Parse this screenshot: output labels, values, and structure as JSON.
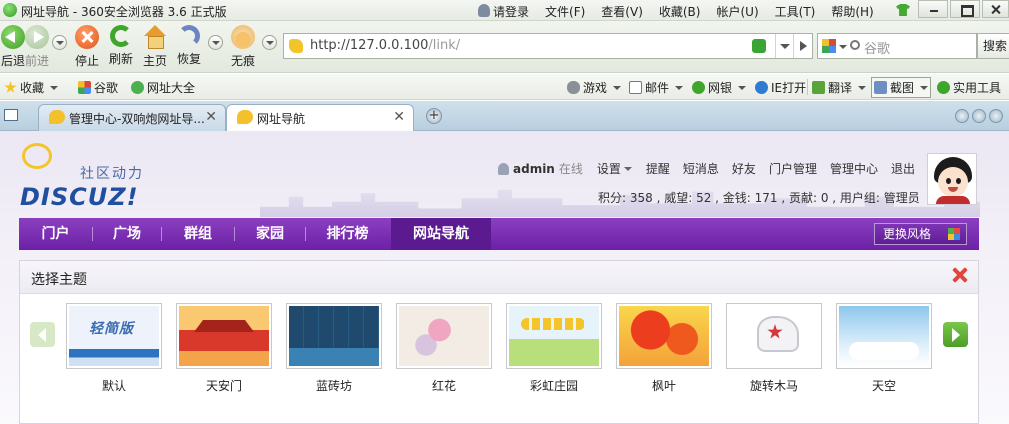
{
  "window": {
    "title": "网址导航 - 360安全浏览器 3.6 正式版",
    "menu": [
      "请登录",
      "文件(F)",
      "查看(V)",
      "收藏(B)",
      "帐户(U)",
      "工具(T)",
      "帮助(H)"
    ]
  },
  "toolbar": {
    "back_label": "后退",
    "forward_label": "前进",
    "stop_label": "停止",
    "refresh_label": "刷新",
    "home_label": "主页",
    "restore_label": "恢复",
    "incognito_label": "无痕",
    "url_host": "http://127.0.0.100",
    "url_path": "/link/",
    "search_placeholder": "谷歌",
    "search_button": "搜索"
  },
  "bookmarks": {
    "left": [
      "收藏",
      "谷歌",
      "网址大全"
    ],
    "right": [
      "游戏",
      "邮件",
      "网银",
      "IE打开",
      "翻译",
      "截图",
      "实用工具"
    ]
  },
  "tabs": [
    {
      "label": "管理中心-双响炮网址导..."
    },
    {
      "label": "网址导航"
    }
  ],
  "site": {
    "logo_tagline": "社区动力",
    "logo_word": "DISCUZ!",
    "username": "admin",
    "online_status": "在线",
    "links": [
      "设置",
      "提醒",
      "短消息",
      "好友",
      "门户管理",
      "管理中心",
      "退出"
    ],
    "stats": "积分: 358 , 威望: 52 , 金钱: 171 , 贡献: 0 , 用户组: 管理员",
    "nav": [
      "门户",
      "广场",
      "群组",
      "家园",
      "排行榜",
      "网站导航"
    ],
    "active_nav": "网站导航",
    "change_style": "更换风格"
  },
  "theme_panel": {
    "title": "选择主题",
    "default_thumb_text": "轻简版",
    "themes": [
      "默认",
      "天安门",
      "蓝砖坊",
      "红花",
      "彩虹庄园",
      "枫叶",
      "旋转木马",
      "天空"
    ]
  },
  "colors": {
    "nav_purple": "#7a2fb4",
    "active_nav": "#5b1a8f",
    "close_red": "#e2463a",
    "next_green": "#5fae34"
  }
}
